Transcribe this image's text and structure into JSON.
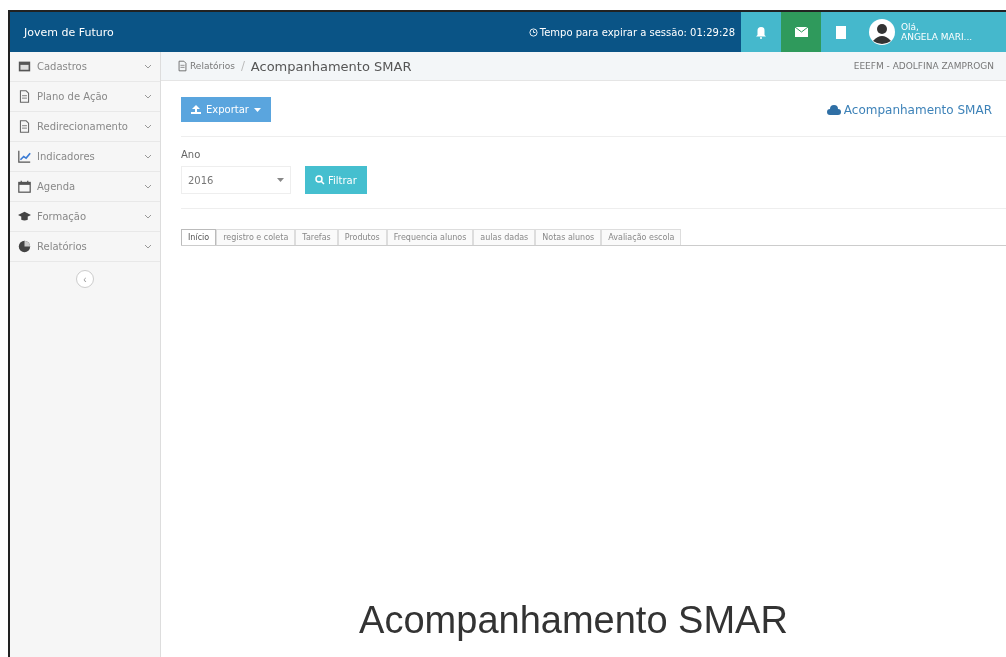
{
  "app_title": "Jovem de Futuro",
  "session": {
    "text": "Tempo para expirar a sessão: 01:29:28"
  },
  "user": {
    "greeting": "Olá,",
    "name": "ANGELA MARI..."
  },
  "sidebar": {
    "items": [
      {
        "label": "Cadastros"
      },
      {
        "label": "Plano de Ação"
      },
      {
        "label": "Redirecionamento"
      },
      {
        "label": "Indicadores"
      },
      {
        "label": "Agenda"
      },
      {
        "label": "Formação"
      },
      {
        "label": "Relatórios"
      }
    ],
    "collapse": "‹"
  },
  "breadcrumb": {
    "parent": "Relatórios",
    "current": "Acompanhamento SMAR",
    "school": "EEEFM - ADOLFINA ZAMPROGN"
  },
  "export_button": "Exportar",
  "page_title": "Acompanhamento SMAR",
  "filter": {
    "label": "Ano",
    "value": "2016",
    "button": "Filtrar"
  },
  "tabs": [
    {
      "label": "Início",
      "selected": true
    },
    {
      "label": "registro e coleta",
      "selected": false
    },
    {
      "label": "Tarefas",
      "selected": false
    },
    {
      "label": "Produtos",
      "selected": false
    },
    {
      "label": "Frequencia alunos",
      "selected": false
    },
    {
      "label": "aulas dadas",
      "selected": false
    },
    {
      "label": "Notas alunos",
      "selected": false
    },
    {
      "label": "Avaliação escola",
      "selected": false
    }
  ],
  "report_heading": "Acompanhamento SMAR"
}
